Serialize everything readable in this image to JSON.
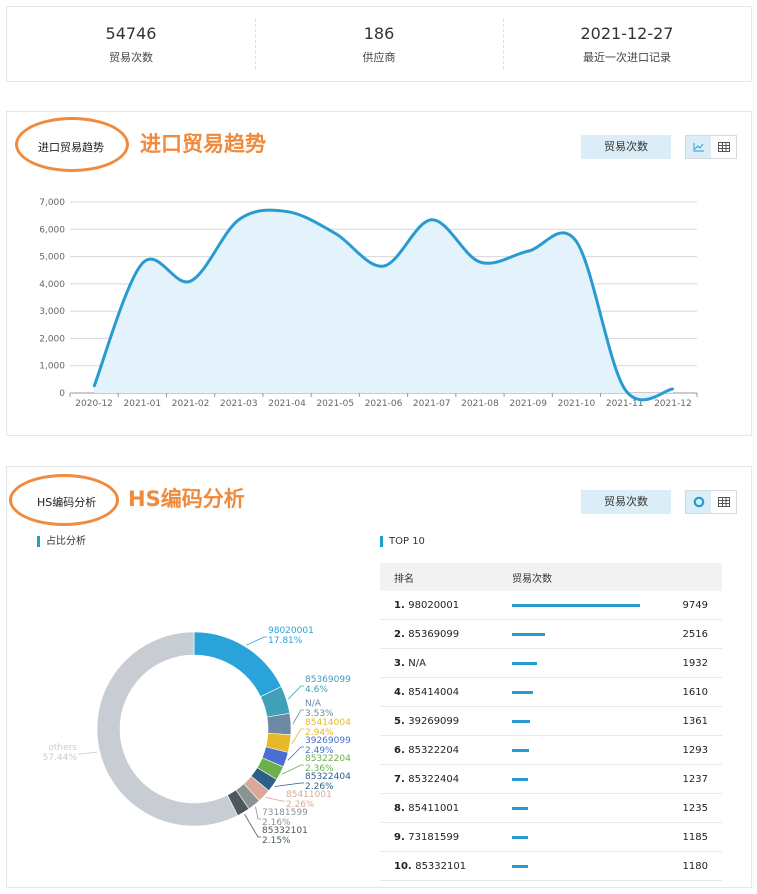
{
  "stats": [
    {
      "value": "54746",
      "label": "贸易次数"
    },
    {
      "value": "186",
      "label": "供应商"
    },
    {
      "value": "2021-12-27",
      "label": "最近一次进口记录"
    }
  ],
  "trend_panel": {
    "title": "进口贸易趋势",
    "big_title": "进口贸易趋势",
    "metric_button": "贸易次数",
    "icons": [
      "line-chart-icon",
      "table-icon"
    ]
  },
  "hs_panel": {
    "title": "HS编码分析",
    "big_title": "HS编码分析",
    "metric_button": "贸易次数",
    "icons": [
      "donut-chart-icon",
      "table-icon"
    ],
    "share_title": "占比分析",
    "top_title": "TOP 10",
    "table_headers": [
      "排名",
      "贸易次数"
    ]
  },
  "top10": [
    {
      "rank": "1.",
      "code": "98020001",
      "count": 9749,
      "count_text": "9749"
    },
    {
      "rank": "2.",
      "code": "85369099",
      "count": 2516,
      "count_text": "2516"
    },
    {
      "rank": "3.",
      "code": "N/A",
      "count": 1932,
      "count_text": "1932"
    },
    {
      "rank": "4.",
      "code": "85414004",
      "count": 1610,
      "count_text": "1610"
    },
    {
      "rank": "5.",
      "code": "39269099",
      "count": 1361,
      "count_text": "1361"
    },
    {
      "rank": "6.",
      "code": "85322204",
      "count": 1293,
      "count_text": "1293"
    },
    {
      "rank": "7.",
      "code": "85322404",
      "count": 1237,
      "count_text": "1237"
    },
    {
      "rank": "8.",
      "code": "85411001",
      "count": 1235,
      "count_text": "1235"
    },
    {
      "rank": "9.",
      "code": "73181599",
      "count": 1185,
      "count_text": "1185"
    },
    {
      "rank": "10.",
      "code": "85332101",
      "count": 1180,
      "count_text": "1180"
    }
  ],
  "chart_data": [
    {
      "type": "area",
      "title": "进口贸易趋势",
      "xlabel": "",
      "ylabel": "",
      "categories": [
        "2020-12",
        "2021-01",
        "2021-02",
        "2021-03",
        "2021-04",
        "2021-05",
        "2021-06",
        "2021-07",
        "2021-08",
        "2021-09",
        "2021-10",
        "2021-11",
        "2021-12"
      ],
      "series": [
        {
          "values": [
            250,
            4750,
            4100,
            6350,
            6650,
            5850,
            4650,
            6350,
            4800,
            5200,
            5550,
            150,
            150
          ]
        }
      ],
      "ylim": [
        0,
        7000
      ],
      "yticks": [
        0,
        1000,
        2000,
        3000,
        4000,
        5000,
        6000,
        7000
      ],
      "ytick_labels": [
        "0",
        "1,000",
        "2,000",
        "3,000",
        "4,000",
        "5,000",
        "6,000",
        "7,000"
      ],
      "grid": true,
      "line_color": "#2a9bd0",
      "fill_color": "#e4f3fb"
    },
    {
      "type": "pie",
      "title": "占比分析",
      "slices": [
        {
          "label": "98020001",
          "value": 17.81,
          "pct_text": "17.81%",
          "color": "#29a3da"
        },
        {
          "label": "85369099",
          "value": 4.6,
          "pct_text": "4.6%",
          "color": "#3fa0b8"
        },
        {
          "label": "N/A",
          "value": 3.53,
          "pct_text": "3.53%",
          "color": "#6c8aa3"
        },
        {
          "label": "85414004",
          "value": 2.94,
          "pct_text": "2.94%",
          "color": "#e8b828"
        },
        {
          "label": "39269099",
          "value": 2.49,
          "pct_text": "2.49%",
          "color": "#4a6fd0"
        },
        {
          "label": "85322204",
          "value": 2.36,
          "pct_text": "2.36%",
          "color": "#6bb04a"
        },
        {
          "label": "85322404",
          "value": 2.26,
          "pct_text": "2.26%",
          "color": "#2d5f8a"
        },
        {
          "label": "85411001",
          "value": 2.26,
          "pct_text": "2.26%",
          "color": "#d9a898"
        },
        {
          "label": "73181599",
          "value": 2.16,
          "pct_text": "2.16%",
          "color": "#8a9294"
        },
        {
          "label": "85332101",
          "value": 2.15,
          "pct_text": "2.15%",
          "color": "#4e585c"
        },
        {
          "label": "others",
          "value": 57.44,
          "pct_text": "57.44%",
          "color": "#c7cdd2"
        }
      ]
    }
  ]
}
